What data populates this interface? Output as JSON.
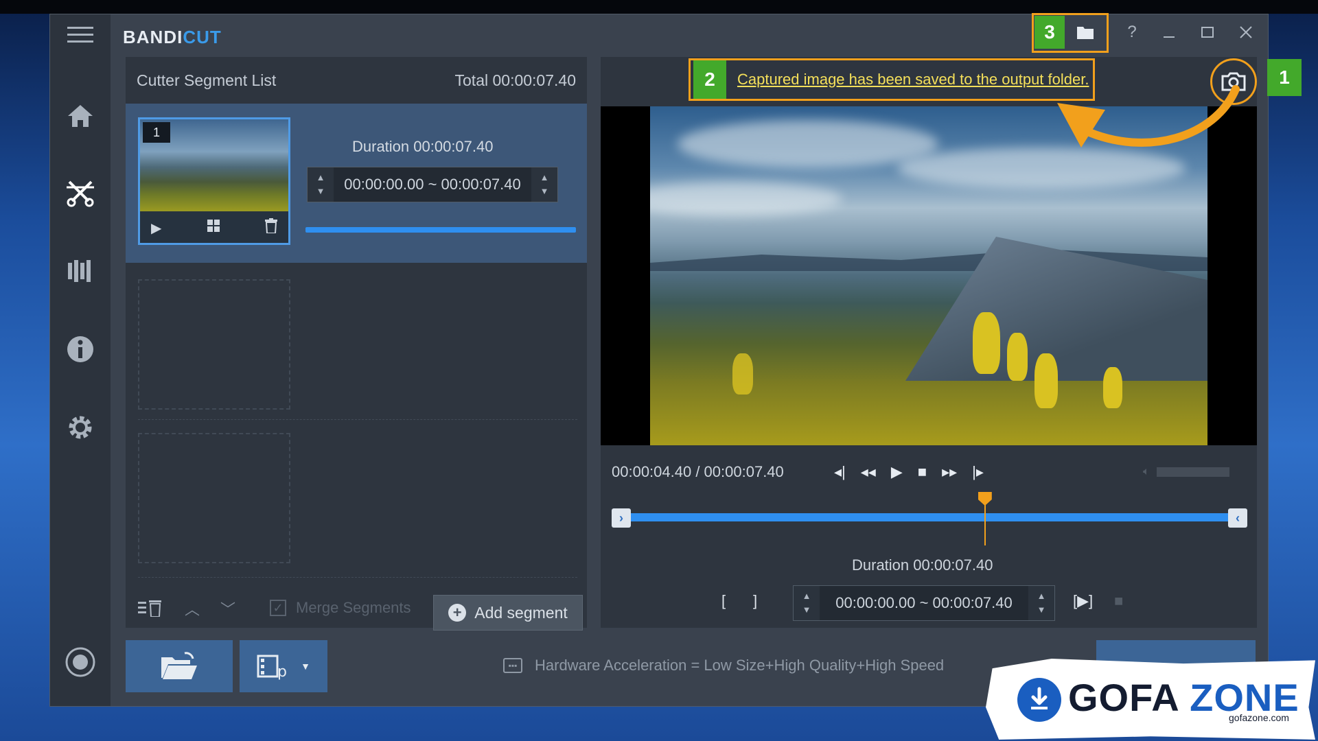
{
  "app": {
    "logo_bandi": "BANDI",
    "logo_cut": "CUT"
  },
  "titlebar": {
    "help": "?",
    "badge_3": "3"
  },
  "left_panel": {
    "header_title": "Cutter Segment List",
    "header_total": "Total 00:00:07.40",
    "segment": {
      "number": "1",
      "duration": "Duration 00:00:07.40",
      "range": "00:00:00.00 ~ 00:00:07.40"
    },
    "footer": {
      "merge_label": "Merge Segments",
      "add_segment": "Add segment"
    }
  },
  "right_panel": {
    "badge_2": "2",
    "notice": "Captured image has been saved to the output folder.",
    "badge_1": "1",
    "time": "00:00:04.40 / 00:00:07.40",
    "duration": "Duration 00:00:07.40",
    "range": "00:00:00.00 ~ 00:00:07.40",
    "playhead_fraction": 0.59
  },
  "bottom": {
    "hardware": "Hardware Acceleration = Low Size+High Quality+High Speed"
  },
  "watermark": {
    "main_a": "GOFA ",
    "main_b": "ZONE",
    "sub": "gofazone.com"
  },
  "colors": {
    "accent_blue": "#2f8ff0",
    "highlight_orange": "#f2a01c",
    "badge_green": "#43a92b",
    "notice_yellow": "#f5e05a"
  }
}
